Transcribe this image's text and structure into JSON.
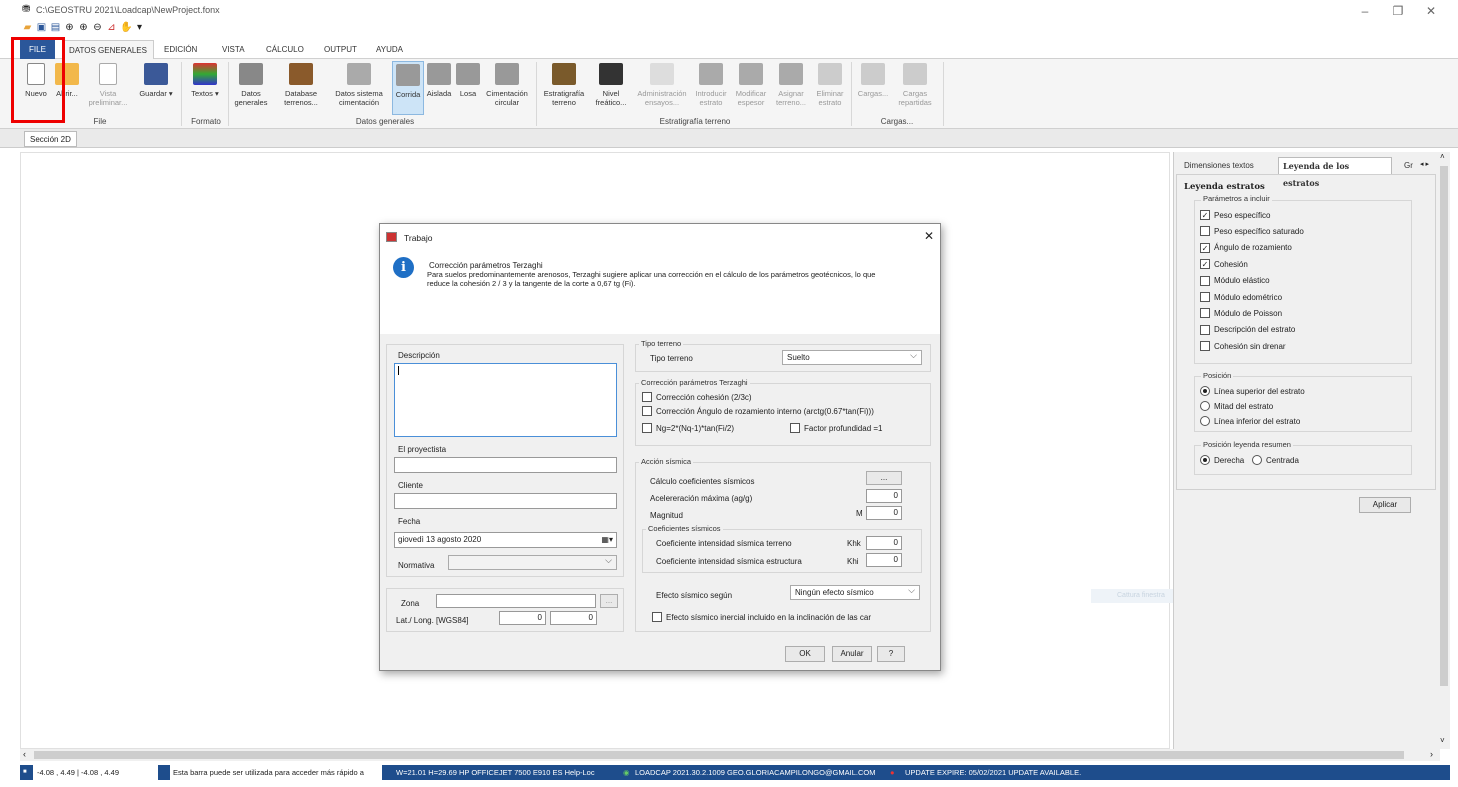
{
  "window": {
    "title": "C:\\GEOSTRU 2021\\Loadcap\\NewProject.fonx"
  },
  "menu_tabs": [
    "FILE",
    "DATOS GENERALES",
    "EDICIÓN",
    "VISTA",
    "CÁLCULO",
    "OUTPUT",
    "AYUDA"
  ],
  "ribbon": {
    "buttons": [
      "Nuevo",
      "Abrir...",
      "Vista preliminar...",
      "Guardar",
      "Textos",
      "Datos generales",
      "Database terrenos...",
      "Datos sistema cimentación",
      "Corrida",
      "Aislada",
      "Losa",
      "Cimentación circular",
      "Estratigrafía terreno",
      "Nivel freático...",
      "Administración ensayos...",
      "Introducir estrato",
      "Modificar espesor",
      "Asignar terreno...",
      "Eliminar estrato",
      "Cargas...",
      "Cargas repartidas"
    ],
    "groups": [
      "File",
      "Formato",
      "Datos generales",
      "Estratigrafía terreno",
      "Cargas..."
    ]
  },
  "doc_tab": "Sección 2D",
  "right_panel": {
    "tabs": [
      "Dimensiones textos",
      "Leyenda de los estratos",
      "Gr"
    ],
    "section_title": "Leyenda estratos",
    "params_title": "Parámetros a incluir",
    "params": [
      {
        "label": "Peso específico",
        "checked": true
      },
      {
        "label": "Peso específico saturado",
        "checked": false
      },
      {
        "label": "Ángulo de rozamiento",
        "checked": true
      },
      {
        "label": "Cohesión",
        "checked": true
      },
      {
        "label": "Módulo elástico",
        "checked": false
      },
      {
        "label": "Módulo edométrico",
        "checked": false
      },
      {
        "label": "Módulo de Poisson",
        "checked": false
      },
      {
        "label": "Descripción del estrato",
        "checked": false
      },
      {
        "label": "Cohesión sin drenar",
        "checked": false
      }
    ],
    "position_title": "Posición",
    "positions": [
      "Línea superior del estrato",
      "Mitad del estrato",
      "Línea inferior del estrato"
    ],
    "summary_title": "Posición leyenda resumen",
    "summary_options": [
      "Derecha",
      "Centrada"
    ],
    "apply": "Aplicar"
  },
  "watermark": "Cattura finestra",
  "dialog": {
    "title": "Trabajo",
    "info_title": "Corrección parámetros Terzaghi",
    "info_text1": "Para suelos predominantemente arenosos, Terzaghi sugiere aplicar una corrección en el cálculo de los parámetros geotécnicos, lo que",
    "info_text2": "reduce la cohesión 2 / 3 y la tangente de la corte a 0,67 tg (Fi).",
    "descripcion": "Descripción",
    "proyectista": "El proyectista",
    "cliente": "Cliente",
    "fecha": "Fecha",
    "fecha_value": "giovedì  13   agosto   2020",
    "normativa": "Normativa",
    "zona": "Zona",
    "latlong": "Lat./ Long. [WGS84]",
    "lat": "0",
    "long": "0",
    "tipo_group": "Tipo terreno",
    "tipo_label": "Tipo terreno",
    "tipo_value": "Suelto",
    "corr_group": "Corrección parámetros Terzaghi",
    "corr1": "Corrección cohesión (2/3c)",
    "corr2": "Corrección Ángulo de rozamiento interno (arctg(0.67*tan(Fi)))",
    "corr3": "Ng=2*(Nq-1)*tan(Fi/2)",
    "corr4": "Factor profundidad =1",
    "sism_group": "Acción sísmica",
    "calc_coef": "Cálculo coeficientes sísmicos",
    "calc_btn": "...",
    "acel": "Acelereración máxima (ag/g)",
    "acel_val": "0",
    "magn": "Magnitud",
    "magn_unit": "M",
    "magn_val": "0",
    "coef_group": "Coeficientes sísmicos",
    "khk_label": "Coeficiente intensidad sísmica terreno",
    "khk": "Khk",
    "khk_val": "0",
    "khi_label": "Coeficiente intensidad sísmica estructura",
    "khi": "Khi",
    "khi_val": "0",
    "efecto_label": "Efecto sísmico según",
    "efecto_value": "Ningún efecto sísmico",
    "inercial": "Efecto sísmico inercial incluido en la inclinación de las car",
    "ok": "OK",
    "cancel": "Anular",
    "help": "?"
  },
  "status": {
    "coords": "-4.08 , 4.49 | -4.08 , 4.49",
    "hint": "Esta barra puede ser utilizada para acceder más rápido a",
    "printer": "W=21.01 H=29.69 HP OFFICEJET 7500 E910  ES   Help-Loc",
    "license": "LOADCAP 2021.30.2.1009 GEO.GLORIACAMPILONGO@GMAIL.COM",
    "update": "UPDATE EXPIRE: 05/02/2021 UPDATE AVAILABLE."
  }
}
